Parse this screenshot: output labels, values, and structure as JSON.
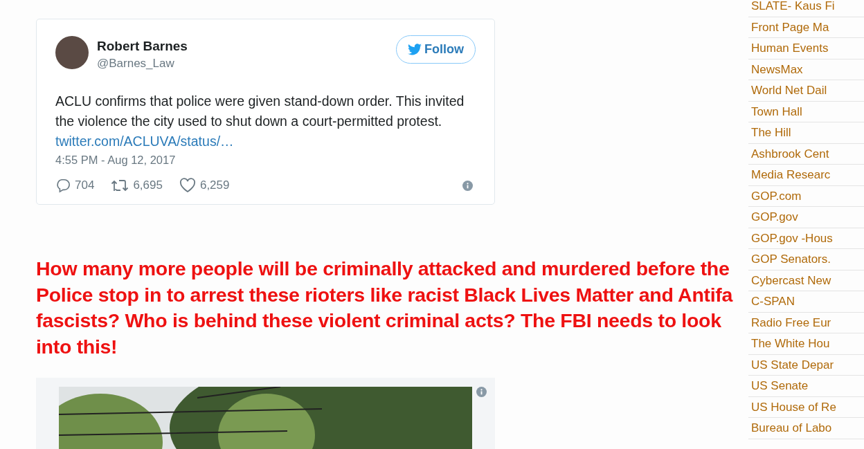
{
  "tweet": {
    "name": "Robert Barnes",
    "handle": "@Barnes_Law",
    "follow_label": "Follow",
    "text_before": "ACLU confirms that police were given stand-down order. This invited the violence the city used to shut down a court-permitted protest.",
    "link": "twitter.com/ACLUVA/status/…",
    "timestamp": "4:55 PM - Aug 12, 2017",
    "replies": "704",
    "retweets": "6,695",
    "likes": "6,259"
  },
  "headline": "How many more people will be criminally attacked and murdered before the Police stop in to arrest these rioters like racist Black Lives Matter and Antifa fascists?  Who is behind these violent criminal acts?  The FBI needs to look into this!",
  "sidebar": {
    "links": [
      "SLATE- Kaus Fi",
      "Front Page Ma",
      "Human Events",
      "NewsMax",
      "World Net Dail",
      "Town Hall",
      "The Hill",
      "Ashbrook Cent",
      "Media Researc",
      "GOP.com",
      "GOP.gov",
      "GOP.gov -Hous",
      "GOP Senators.",
      "Cybercast New",
      "C-SPAN",
      "Radio Free Eur",
      "The White Hou",
      "US State Depar",
      "US Senate",
      "US House of Re",
      "Bureau of Labo"
    ]
  }
}
